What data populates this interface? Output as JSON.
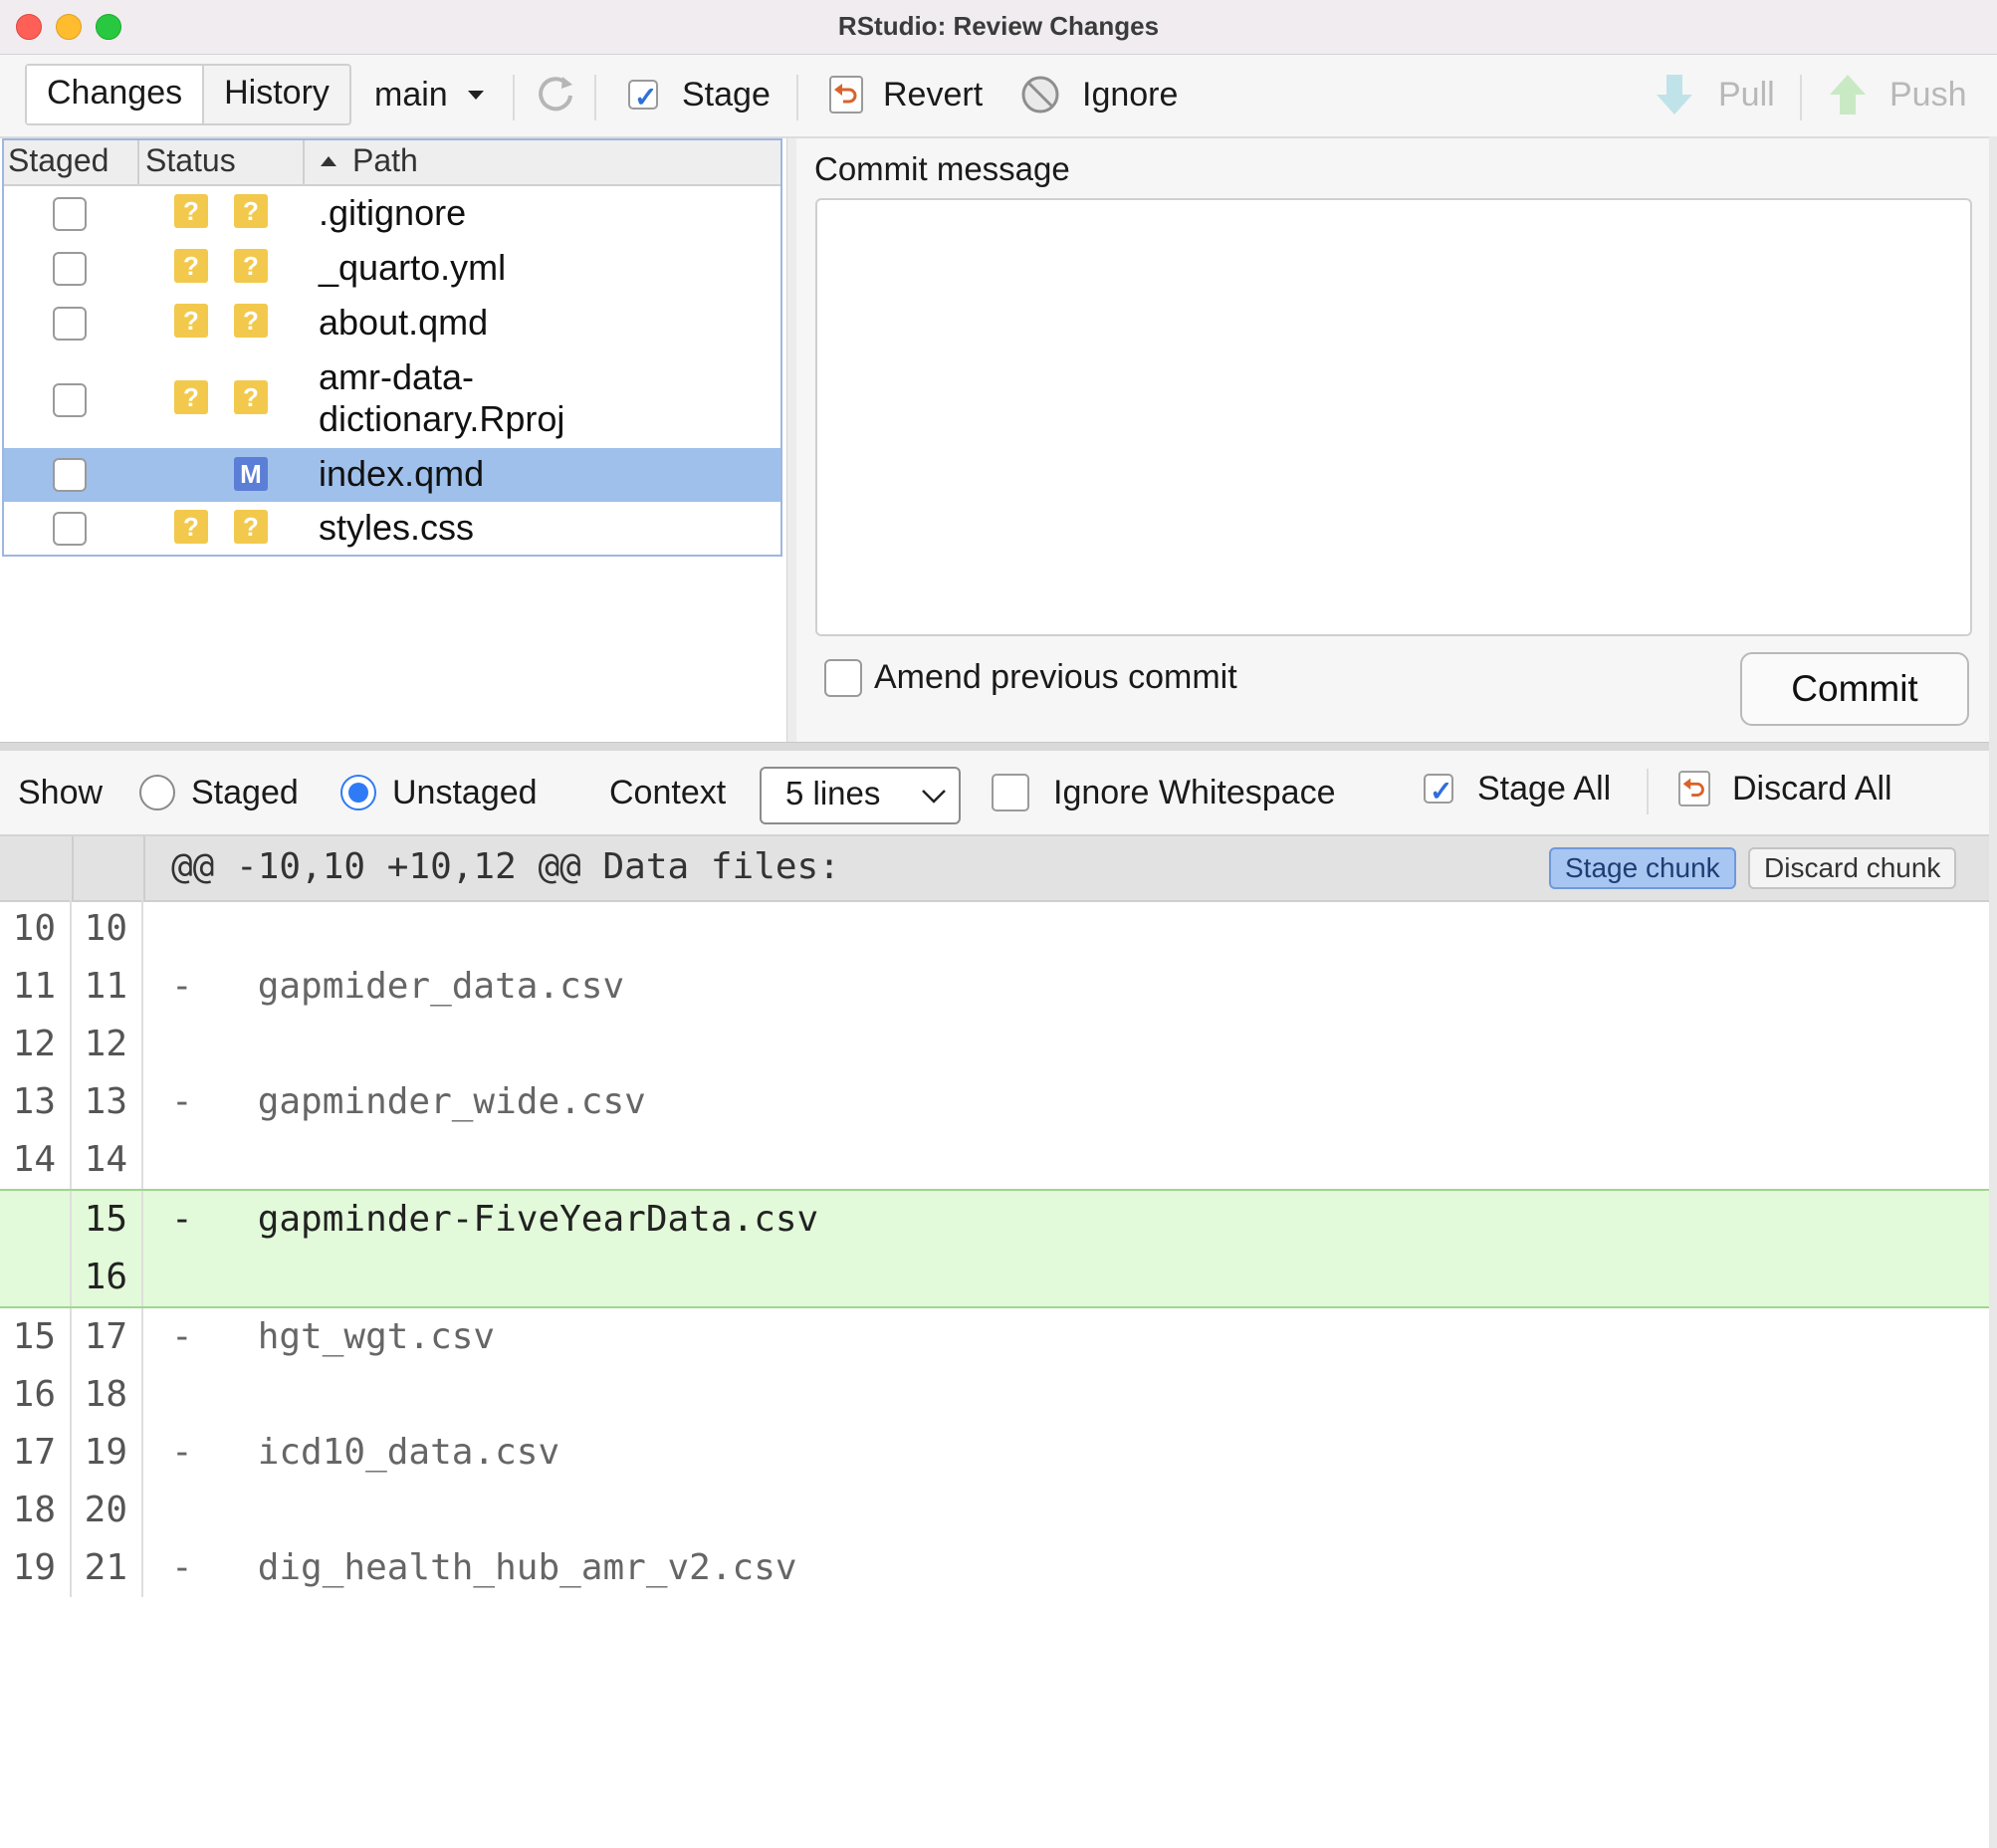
{
  "window": {
    "title": "RStudio: Review Changes"
  },
  "toolbar": {
    "tabs": [
      "Changes",
      "History"
    ],
    "branch": "main",
    "stage_label": "Stage",
    "revert_label": "Revert",
    "ignore_label": "Ignore",
    "pull_label": "Pull",
    "push_label": "Push"
  },
  "file_list": {
    "columns": [
      "Staged",
      "Status",
      "Path"
    ],
    "files": [
      {
        "path": ".gitignore",
        "status": [
          "?",
          "?"
        ]
      },
      {
        "path": "_quarto.yml",
        "status": [
          "?",
          "?"
        ]
      },
      {
        "path": "about.qmd",
        "status": [
          "?",
          "?"
        ]
      },
      {
        "path": "amr-data-\ndictionary.Rproj",
        "status": [
          "?",
          "?"
        ]
      },
      {
        "path": "index.qmd",
        "status": [
          "",
          "M"
        ],
        "selected": true
      },
      {
        "path": "styles.css",
        "status": [
          "?",
          "?"
        ]
      }
    ]
  },
  "commit": {
    "label": "Commit message",
    "message": "",
    "amend_label": "Amend previous commit",
    "button_label": "Commit"
  },
  "diff_options": {
    "show_label": "Show",
    "staged_label": "Staged",
    "unstaged_label": "Unstaged",
    "selected_view": "Unstaged",
    "context_label": "Context",
    "context_value": "5 lines",
    "ignore_ws_label": "Ignore Whitespace",
    "stage_all_label": "Stage All",
    "discard_all_label": "Discard All"
  },
  "diff": {
    "hunk_header": "@@ -10,10 +10,12 @@ Data files:",
    "stage_chunk_label": "Stage chunk",
    "discard_chunk_label": "Discard chunk",
    "lines": [
      {
        "old": "10",
        "new": "10",
        "text": ""
      },
      {
        "old": "11",
        "new": "11",
        "text": "-   gapmider_data.csv"
      },
      {
        "old": "12",
        "new": "12",
        "text": ""
      },
      {
        "old": "13",
        "new": "13",
        "text": "-   gapminder_wide.csv"
      },
      {
        "old": "14",
        "new": "14",
        "text": ""
      },
      {
        "old": "",
        "new": "15",
        "text": "-   gapminder-FiveYearData.csv",
        "added": true
      },
      {
        "old": "",
        "new": "16",
        "text": "",
        "added": true
      },
      {
        "old": "15",
        "new": "17",
        "text": "-   hgt_wgt.csv"
      },
      {
        "old": "16",
        "new": "18",
        "text": ""
      },
      {
        "old": "17",
        "new": "19",
        "text": "-   icd10_data.csv"
      },
      {
        "old": "18",
        "new": "20",
        "text": ""
      },
      {
        "old": "19",
        "new": "21",
        "text": "-   dig_health_hub_amr_v2.csv"
      }
    ]
  },
  "colors": {
    "selected_row": "#9fc0ea",
    "added_line": "#e2fad9",
    "untracked_badge": "#f2c94c",
    "modified_badge": "#5b7fd6",
    "accent": "#2f7bf5"
  }
}
